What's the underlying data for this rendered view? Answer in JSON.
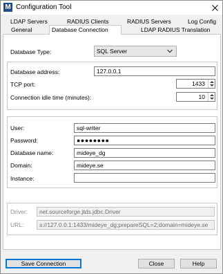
{
  "window": {
    "title": "Configuration Tool",
    "app_icon_letter": "M"
  },
  "tabs": {
    "row1": [
      "LDAP Servers",
      "RADIUS Clients",
      "RADIUS Servers",
      "Log Config"
    ],
    "row2": [
      "General",
      "Database Connection",
      "LDAP RADIUS Translation"
    ],
    "active": "Database Connection"
  },
  "db": {
    "type_label": "Database Type:",
    "type_value": "SQL Server",
    "address_label": "Database address:",
    "address_value": "127.0.0.1",
    "port_label": "TCP port:",
    "port_value": "1433",
    "idle_label": "Connection idle time (minutes):",
    "idle_value": "10"
  },
  "auth": {
    "user_label": "User:",
    "user_value": "sql-writer",
    "password_label": "Password:",
    "password_value": "●●●●●●●●",
    "dbname_label": "Database name:",
    "dbname_value": "mideye_dg",
    "domain_label": "Domain:",
    "domain_value": "mideye.se",
    "instance_label": "Instance:",
    "instance_value": ""
  },
  "driver": {
    "driver_label": "Driver:",
    "driver_value": "net.sourceforge.jtds.jdbc.Driver",
    "url_label": "URL:",
    "url_value": "s://127.0.0.1:1433/mideye_dg;prepareSQL=2;domain=mideye.se"
  },
  "buttons": {
    "save": "Save Connection",
    "close": "Close",
    "help": "Help"
  },
  "icons": {
    "app": "mideye-app-icon",
    "close": "close-icon",
    "dropdown": "chevron-down-icon"
  }
}
